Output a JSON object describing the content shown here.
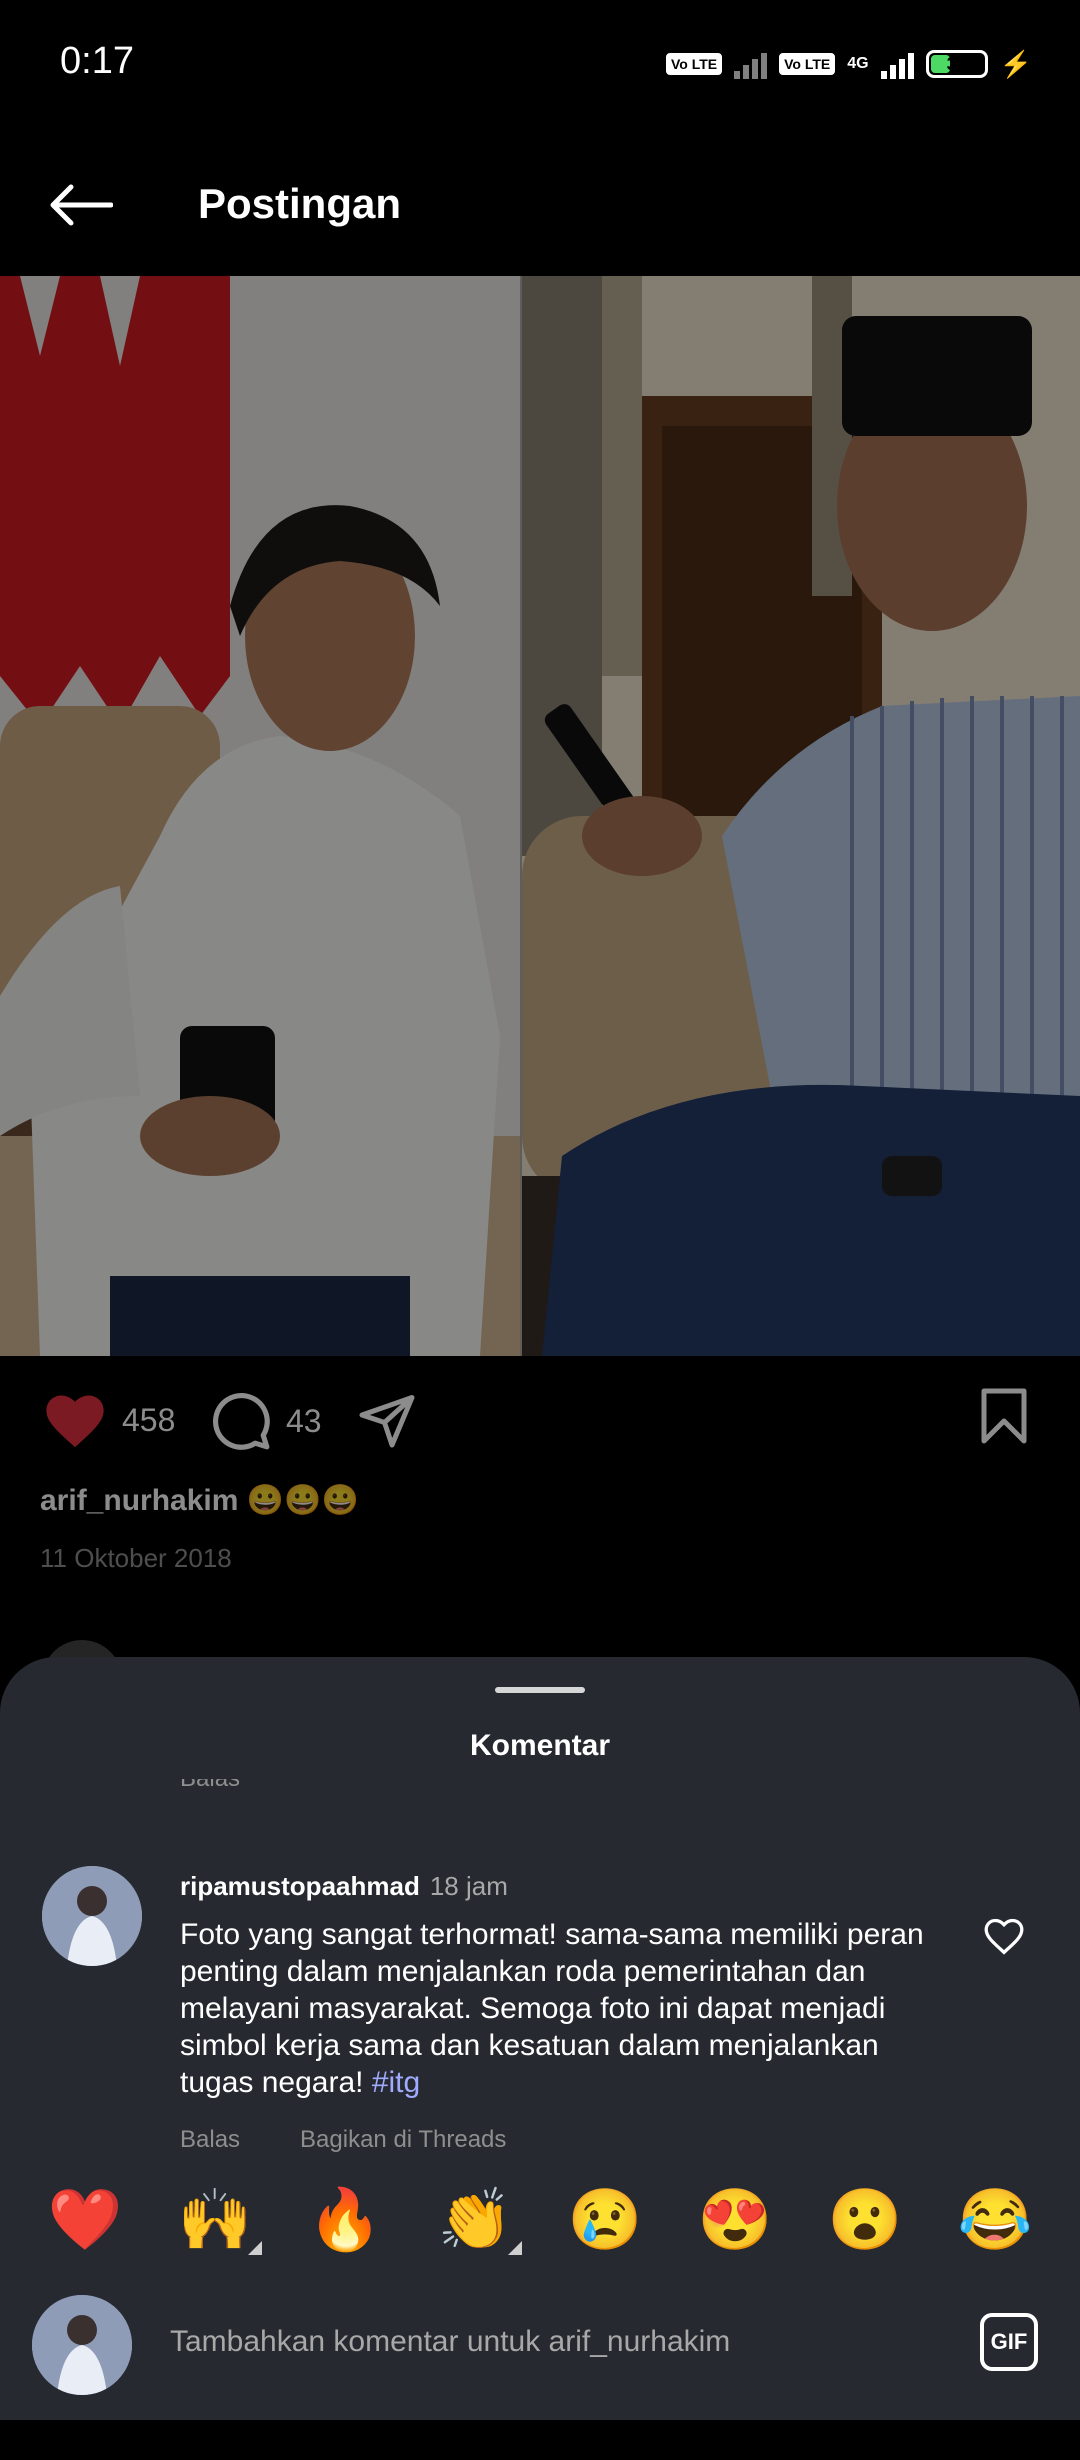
{
  "status_bar": {
    "time": "0:17",
    "sim1": "Vo LTE",
    "network": "4G",
    "sim2": "Vo LTE",
    "battery": "35",
    "battery_level": 0.35
  },
  "header": {
    "title": "Postingan"
  },
  "post": {
    "likes": "458",
    "comments": "43",
    "caption_user": "arif_nurhakim",
    "caption_text": "😀😀😀",
    "date": "11 Oktober 2018"
  },
  "sheet": {
    "title": "Komentar",
    "cut_reply_label": "Balas",
    "comment": {
      "user": "ripamustopaahmad",
      "time": "18 jam",
      "text": "Foto yang sangat terhormat!  sama-sama memiliki peran penting dalam menjalankan roda pemerintahan dan melayani masyarakat. Semoga foto ini dapat menjadi simbol kerja sama dan kesatuan dalam menjalankan tugas negara! ",
      "tag": "#itg",
      "reply": "Balas",
      "share": "Bagikan di Threads"
    },
    "emojis": [
      "❤️",
      "🙌",
      "🔥",
      "👏",
      "😢",
      "😍",
      "😮",
      "😂"
    ],
    "composer_placeholder": "Tambahkan komentar untuk arif_nurhakim",
    "gif_label": "GIF"
  },
  "colors": {
    "like_red": "#e0313f",
    "sheet_bg": "#262a30",
    "hashtag": "#a0aaff"
  }
}
